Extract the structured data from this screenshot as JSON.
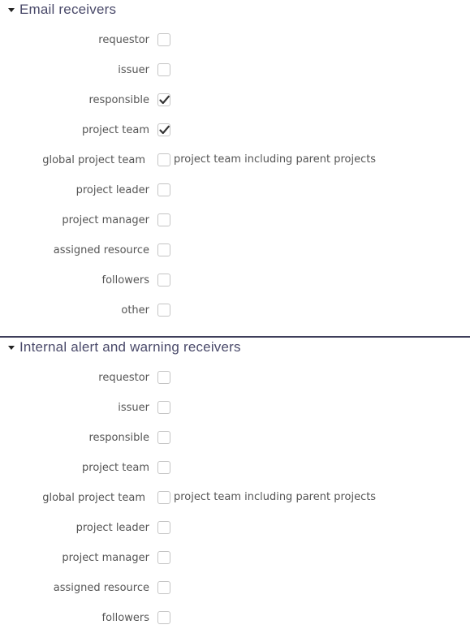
{
  "email_section": {
    "title": "Email receivers",
    "items": [
      {
        "label": "requestor",
        "checked": false
      },
      {
        "label": "issuer",
        "checked": false
      },
      {
        "label": "responsible",
        "checked": true
      },
      {
        "label": "project team",
        "checked": true
      },
      {
        "label": "global project team",
        "checked": false,
        "hint": "project team including parent projects"
      },
      {
        "label": "project leader",
        "checked": false
      },
      {
        "label": "project manager",
        "checked": false
      },
      {
        "label": "assigned resource",
        "checked": false
      },
      {
        "label": "followers",
        "checked": false
      },
      {
        "label": "other",
        "checked": false
      }
    ]
  },
  "internal_section": {
    "title": "Internal alert and warning receivers",
    "items": [
      {
        "label": "requestor",
        "checked": false
      },
      {
        "label": "issuer",
        "checked": false
      },
      {
        "label": "responsible",
        "checked": false
      },
      {
        "label": "project team",
        "checked": false
      },
      {
        "label": "global project team",
        "checked": false,
        "hint": "project team including parent projects"
      },
      {
        "label": "project leader",
        "checked": false
      },
      {
        "label": "project manager",
        "checked": false
      },
      {
        "label": "assigned resource",
        "checked": false
      },
      {
        "label": "followers",
        "checked": false
      }
    ]
  },
  "icons": {
    "collapse": "caret-down-icon",
    "check": "checkmark-icon"
  },
  "colors": {
    "section_title": "#4a4a6a",
    "divider": "#3e3e5a",
    "checkbox_border": "#c4c4c4",
    "label": "#555555"
  }
}
